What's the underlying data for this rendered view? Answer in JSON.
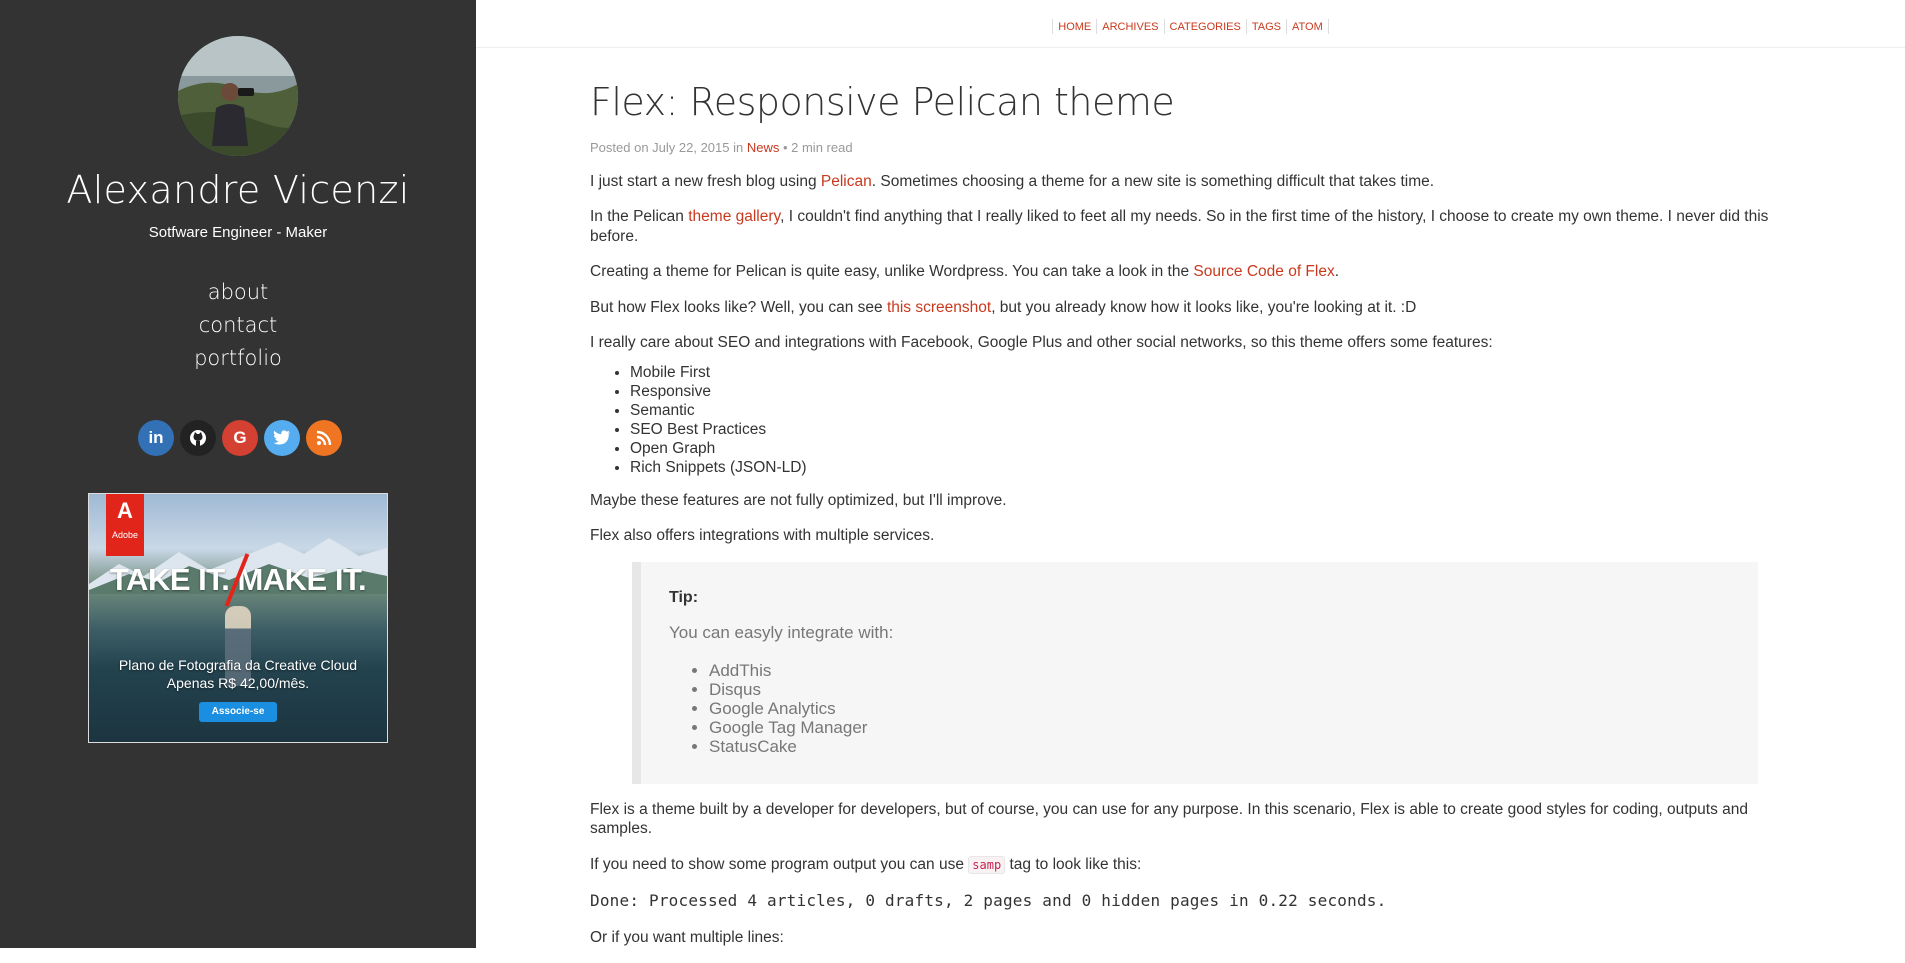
{
  "sidebar": {
    "name": "Alexandre Vicenzi",
    "subtitle": "Sotfware Engineer - Maker",
    "links": [
      "about",
      "contact",
      "portfolio"
    ],
    "social": [
      {
        "icon": "linkedin-icon",
        "glyph": "in",
        "color": "#3371b7"
      },
      {
        "icon": "github-icon",
        "glyph": "●",
        "color": "#222222"
      },
      {
        "icon": "google-icon",
        "glyph": "G",
        "color": "#d44132"
      },
      {
        "icon": "twitter-icon",
        "glyph": "✦",
        "color": "#55acee"
      },
      {
        "icon": "rss-icon",
        "glyph": "◢",
        "color": "#ef7522"
      }
    ],
    "ad": {
      "brand": "Adobe",
      "headline": "TAKE IT. MAKE IT.",
      "caption_line1": "Plano de Fotografia da Creative Cloud",
      "caption_line2": "Apenas R$ 42,00/mês.",
      "button": "Associe-se"
    }
  },
  "nav": [
    "HOME",
    "ARCHIVES",
    "CATEGORIES",
    "TAGS",
    "ATOM"
  ],
  "article": {
    "title": "Flex: Responsive Pelican theme",
    "meta_prefix": "Posted on July 22, 2015 in ",
    "meta_category": "News",
    "meta_suffix": " • 2 min read",
    "p1_a": "I just start a new fresh blog using ",
    "p1_link": "Pelican",
    "p1_b": ". Sometimes choosing a theme for a new site is something difficult that takes time.",
    "p2_a": "In the Pelican ",
    "p2_link": "theme gallery",
    "p2_b": ", I couldn't find anything that I really liked to feet all my needs. So in the first time of the history, I choose to create my own theme. I never did this before.",
    "p3_a": "Creating a theme for Pelican is quite easy, unlike Wordpress. You can take a look in the ",
    "p3_link": "Source Code of Flex",
    "p3_b": ".",
    "p4_a": "But how Flex looks like? Well, you can see ",
    "p4_link": "this screenshot",
    "p4_b": ", but you already know how it looks like, you're looking at it. :D",
    "p5": "I really care about SEO and integrations with Facebook, Google Plus and other social networks, so this theme offers some features:",
    "features": [
      "Mobile First",
      "Responsive",
      "Semantic",
      "SEO Best Practices",
      "Open Graph",
      "Rich Snippets (JSON-LD)"
    ],
    "p6": "Maybe these features are not fully optimized, but I'll improve.",
    "p7": "Flex also offers integrations with multiple services.",
    "tip": {
      "title": "Tip:",
      "text": "You can easyly integrate with:",
      "items": [
        "AddThis",
        "Disqus",
        "Google Analytics",
        "Google Tag Manager",
        "StatusCake"
      ]
    },
    "p8": "Flex is a theme built by a developer for developers, but of course, you can use for any purpose. In this scenario, Flex is able to create good styles for coding, outputs and samples.",
    "p9_a": "If you need to show some program output you can use ",
    "p9_code": "samp",
    "p9_b": " tag to look like this:",
    "output": "Done: Processed 4 articles, 0 drafts, 2 pages and 0 hidden pages in 0.22 seconds.",
    "p10": "Or if you want multiple lines:"
  }
}
